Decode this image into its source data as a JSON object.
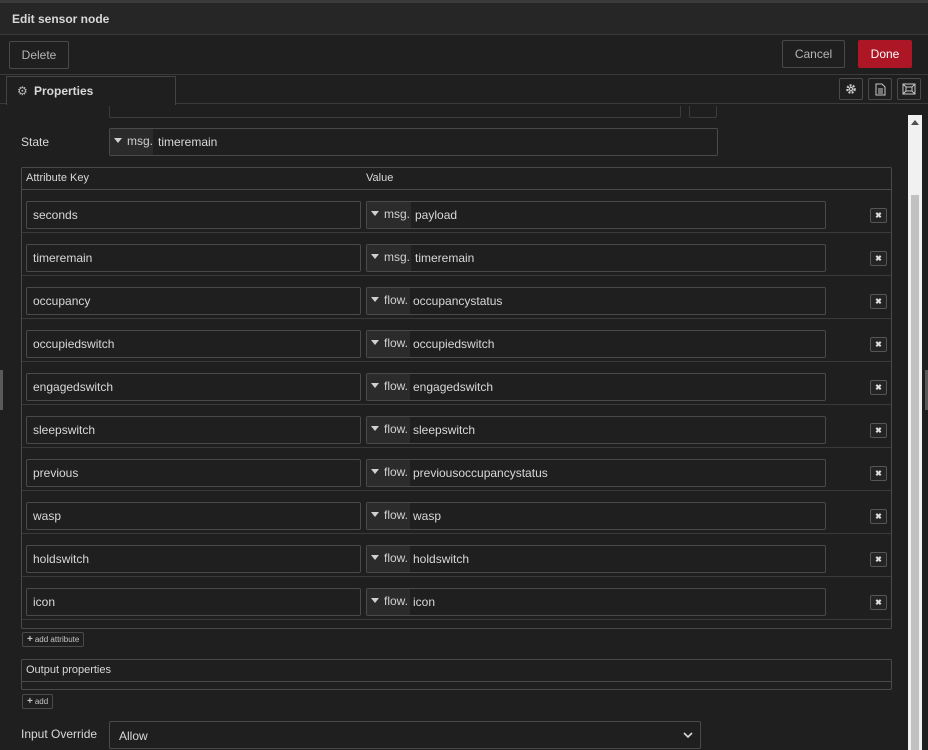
{
  "dialog": {
    "title": "Edit sensor node"
  },
  "toolbar": {
    "delete_label": "Delete",
    "cancel_label": "Cancel",
    "done_label": "Done"
  },
  "tabs": {
    "properties_label": "Properties",
    "buttons": [
      "gear-icon",
      "description-icon",
      "appearance-icon"
    ]
  },
  "state": {
    "label": "State",
    "type": "msg.",
    "value": "timeremain"
  },
  "attributes": {
    "header_key": "Attribute Key",
    "header_value": "Value",
    "rows": [
      {
        "key": "seconds",
        "type": "msg.",
        "value": "payload"
      },
      {
        "key": "timeremain",
        "type": "msg.",
        "value": "timeremain"
      },
      {
        "key": "occupancy",
        "type": "flow.",
        "value": "occupancystatus"
      },
      {
        "key": "occupiedswitch",
        "type": "flow.",
        "value": "occupiedswitch"
      },
      {
        "key": "engagedswitch",
        "type": "flow.",
        "value": "engagedswitch"
      },
      {
        "key": "sleepswitch",
        "type": "flow.",
        "value": "sleepswitch"
      },
      {
        "key": "previous",
        "type": "flow.",
        "value": "previousoccupancystatus"
      },
      {
        "key": "wasp",
        "type": "flow.",
        "value": "wasp"
      },
      {
        "key": "holdswitch",
        "type": "flow.",
        "value": "holdswitch"
      },
      {
        "key": "icon",
        "type": "flow.",
        "value": "icon"
      }
    ],
    "add_label": "add attribute"
  },
  "output": {
    "title": "Output properties",
    "add_label": "add"
  },
  "input_override": {
    "label": "Input Override",
    "value": "Allow"
  },
  "colors": {
    "accent": "#ad1625",
    "background": "#1f1f1f",
    "border": "#4a4a4a"
  }
}
